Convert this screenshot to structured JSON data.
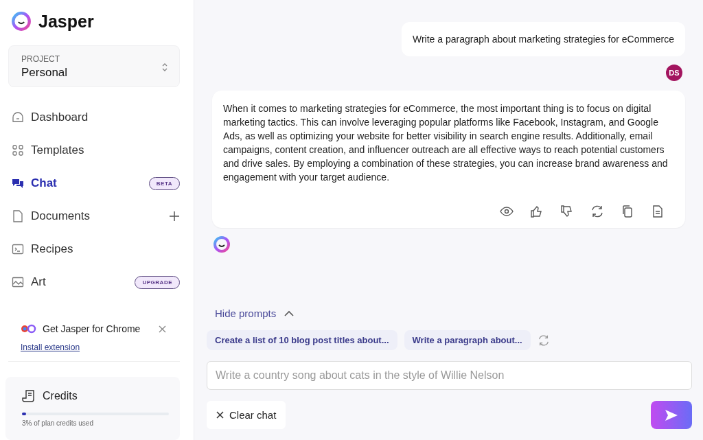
{
  "brand": "Jasper",
  "project": {
    "label": "PROJECT",
    "value": "Personal"
  },
  "nav": [
    {
      "label": "Dashboard",
      "kind": "home",
      "selected": false
    },
    {
      "label": "Templates",
      "kind": "grid",
      "selected": false
    },
    {
      "label": "Chat",
      "kind": "chat",
      "selected": true,
      "badge": "BETA"
    },
    {
      "label": "Documents",
      "kind": "doc",
      "selected": false,
      "add": true
    },
    {
      "label": "Recipes",
      "kind": "terminal",
      "selected": false
    },
    {
      "label": "Art",
      "kind": "image",
      "selected": false,
      "badge": "UPGRADE"
    }
  ],
  "promo": {
    "title": "Get Jasper for Chrome",
    "link": "Install extension"
  },
  "credits": {
    "title": "Credits",
    "level": 0.03,
    "caption": "3% of plan credits used"
  },
  "messages": [
    {
      "kind": "user",
      "text": "Write a paragraph about marketing strategies for eCommerce",
      "avatar": "DS"
    },
    {
      "kind": "ai",
      "text": "When it comes to marketing strategies for eCommerce, the most important thing is to focus on digital marketing tactics. This can involve leveraging popular platforms like Facebook, Instagram, and Google Ads, as well as optimizing your website for better visibility in search engine results. Additionally, email campaigns, content creation, and influencer outreach are all effective ways to reach potential customers and drive sales. By employing a combination of these strategies, you can increase brand awareness and engagement with your target audience."
    }
  ],
  "prompts": {
    "toggle": "Hide prompts",
    "expanded": true,
    "items": [
      "Create a list of 10 blog post titles about...",
      "Write a paragraph about..."
    ]
  },
  "input": {
    "placeholder": "Write a country song about cats in the style of Willie Nelson"
  },
  "clear_button": "Clear chat"
}
